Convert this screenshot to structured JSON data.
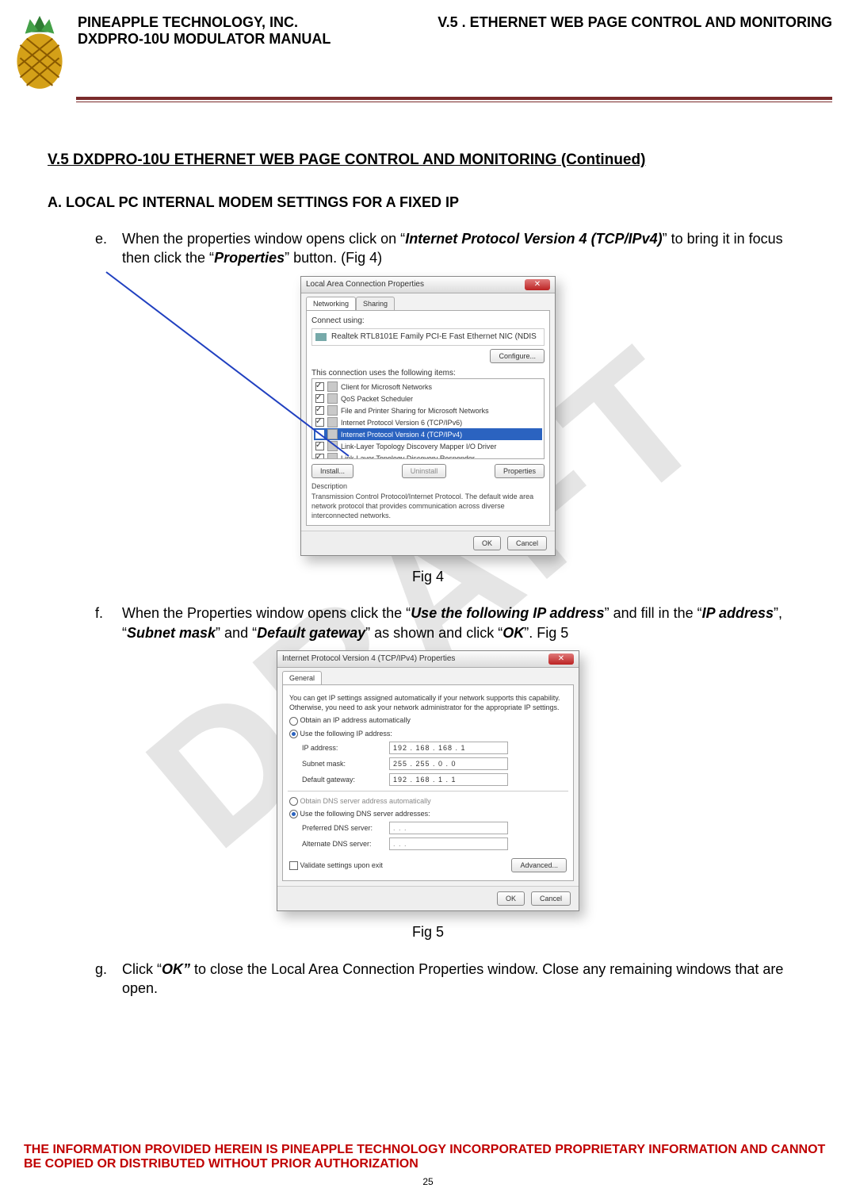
{
  "header": {
    "company": "PINEAPPLE TECHNOLOGY, INC.",
    "manual": "DXDPRO-10U MODULATOR MANUAL",
    "section": "V.5 . ETHERNET WEB PAGE CONTROL AND MONITORING"
  },
  "watermark": "DRAFT",
  "title": {
    "main": "V.5  DXDPRO-10U ETHERNET WEB PAGE CONTROL AND MONITORING",
    "cont": " (Continued)"
  },
  "subsection": "A.   LOCAL PC INTERNAL MODEM SETTINGS FOR A FIXED IP",
  "steps": {
    "e": {
      "marker": "e.",
      "pre": "When the properties window opens click on “",
      "em1": "Internet Protocol Version 4 (TCP/IPv4)",
      "mid": "” to bring it in focus then click the “",
      "em2": "Properties",
      "post": "” button. (Fig 4)"
    },
    "f": {
      "marker": "f.",
      "pre": "When the Properties window opens click the “",
      "em1": "Use the following IP address",
      "mid1": "” and fill in the “",
      "em2": "IP address",
      "mid2": "”, “",
      "em3": "Subnet mask",
      "mid3": "” and “",
      "em4": "Default gateway",
      "mid4": "” as shown and click “",
      "em5": "OK",
      "post": "”. Fig 5"
    },
    "g": {
      "marker": "g.",
      "pre": "Click “",
      "em1": "OK”",
      "post": " to close the Local Area Connection Properties window.  Close any remaining windows that are open."
    }
  },
  "fig4": {
    "label": "Fig 4",
    "title": "Local Area Connection Properties",
    "tabs": {
      "networking": "Networking",
      "sharing": "Sharing"
    },
    "connect_using": "Connect using:",
    "adapter": "Realtek RTL8101E Family PCI-E Fast Ethernet NIC (NDIS",
    "configure": "Configure...",
    "uses_items": "This connection uses the following items:",
    "items": [
      "Client for Microsoft Networks",
      "QoS Packet Scheduler",
      "File and Printer Sharing for Microsoft Networks",
      "Internet Protocol Version 6 (TCP/IPv6)",
      "Internet Protocol Version 4 (TCP/IPv4)",
      "Link-Layer Topology Discovery Mapper I/O Driver",
      "Link-Layer Topology Discovery Responder"
    ],
    "install": "Install...",
    "uninstall": "Uninstall",
    "properties": "Properties",
    "desc_label": "Description",
    "desc_text": "Transmission Control Protocol/Internet Protocol. The default wide area network protocol that provides communication across diverse interconnected networks.",
    "ok": "OK",
    "cancel": "Cancel"
  },
  "fig5": {
    "label": "Fig 5",
    "title": "Internet Protocol Version 4 (TCP/IPv4) Properties",
    "tab": "General",
    "blurb": "You can get IP settings assigned automatically if your network supports this capability. Otherwise, you need to ask your network administrator for the appropriate IP settings.",
    "r_auto_ip": "Obtain an IP address automatically",
    "r_use_ip": "Use the following IP address:",
    "ip_label": "IP address:",
    "ip_value": "192 . 168 . 168 .  1",
    "mask_label": "Subnet mask:",
    "mask_value": "255 . 255 .  0  .  0",
    "gw_label": "Default gateway:",
    "gw_value": "192 . 168 .  1  .  1",
    "r_auto_dns": "Obtain DNS server address automatically",
    "r_use_dns": "Use the following DNS server addresses:",
    "pref_dns": "Preferred DNS server:",
    "alt_dns": "Alternate DNS server:",
    "dns_blank": ".     .     .",
    "validate": "Validate settings upon exit",
    "advanced": "Advanced...",
    "ok": "OK",
    "cancel": "Cancel"
  },
  "footer": {
    "legal": "THE INFORMATION PROVIDED HEREIN IS PINEAPPLE TECHNOLOGY INCORPORATED PROPRIETARY INFORMATION AND CANNOT BE COPIED OR DISTRIBUTED WITHOUT PRIOR AUTHORIZATION",
    "page": "25"
  }
}
